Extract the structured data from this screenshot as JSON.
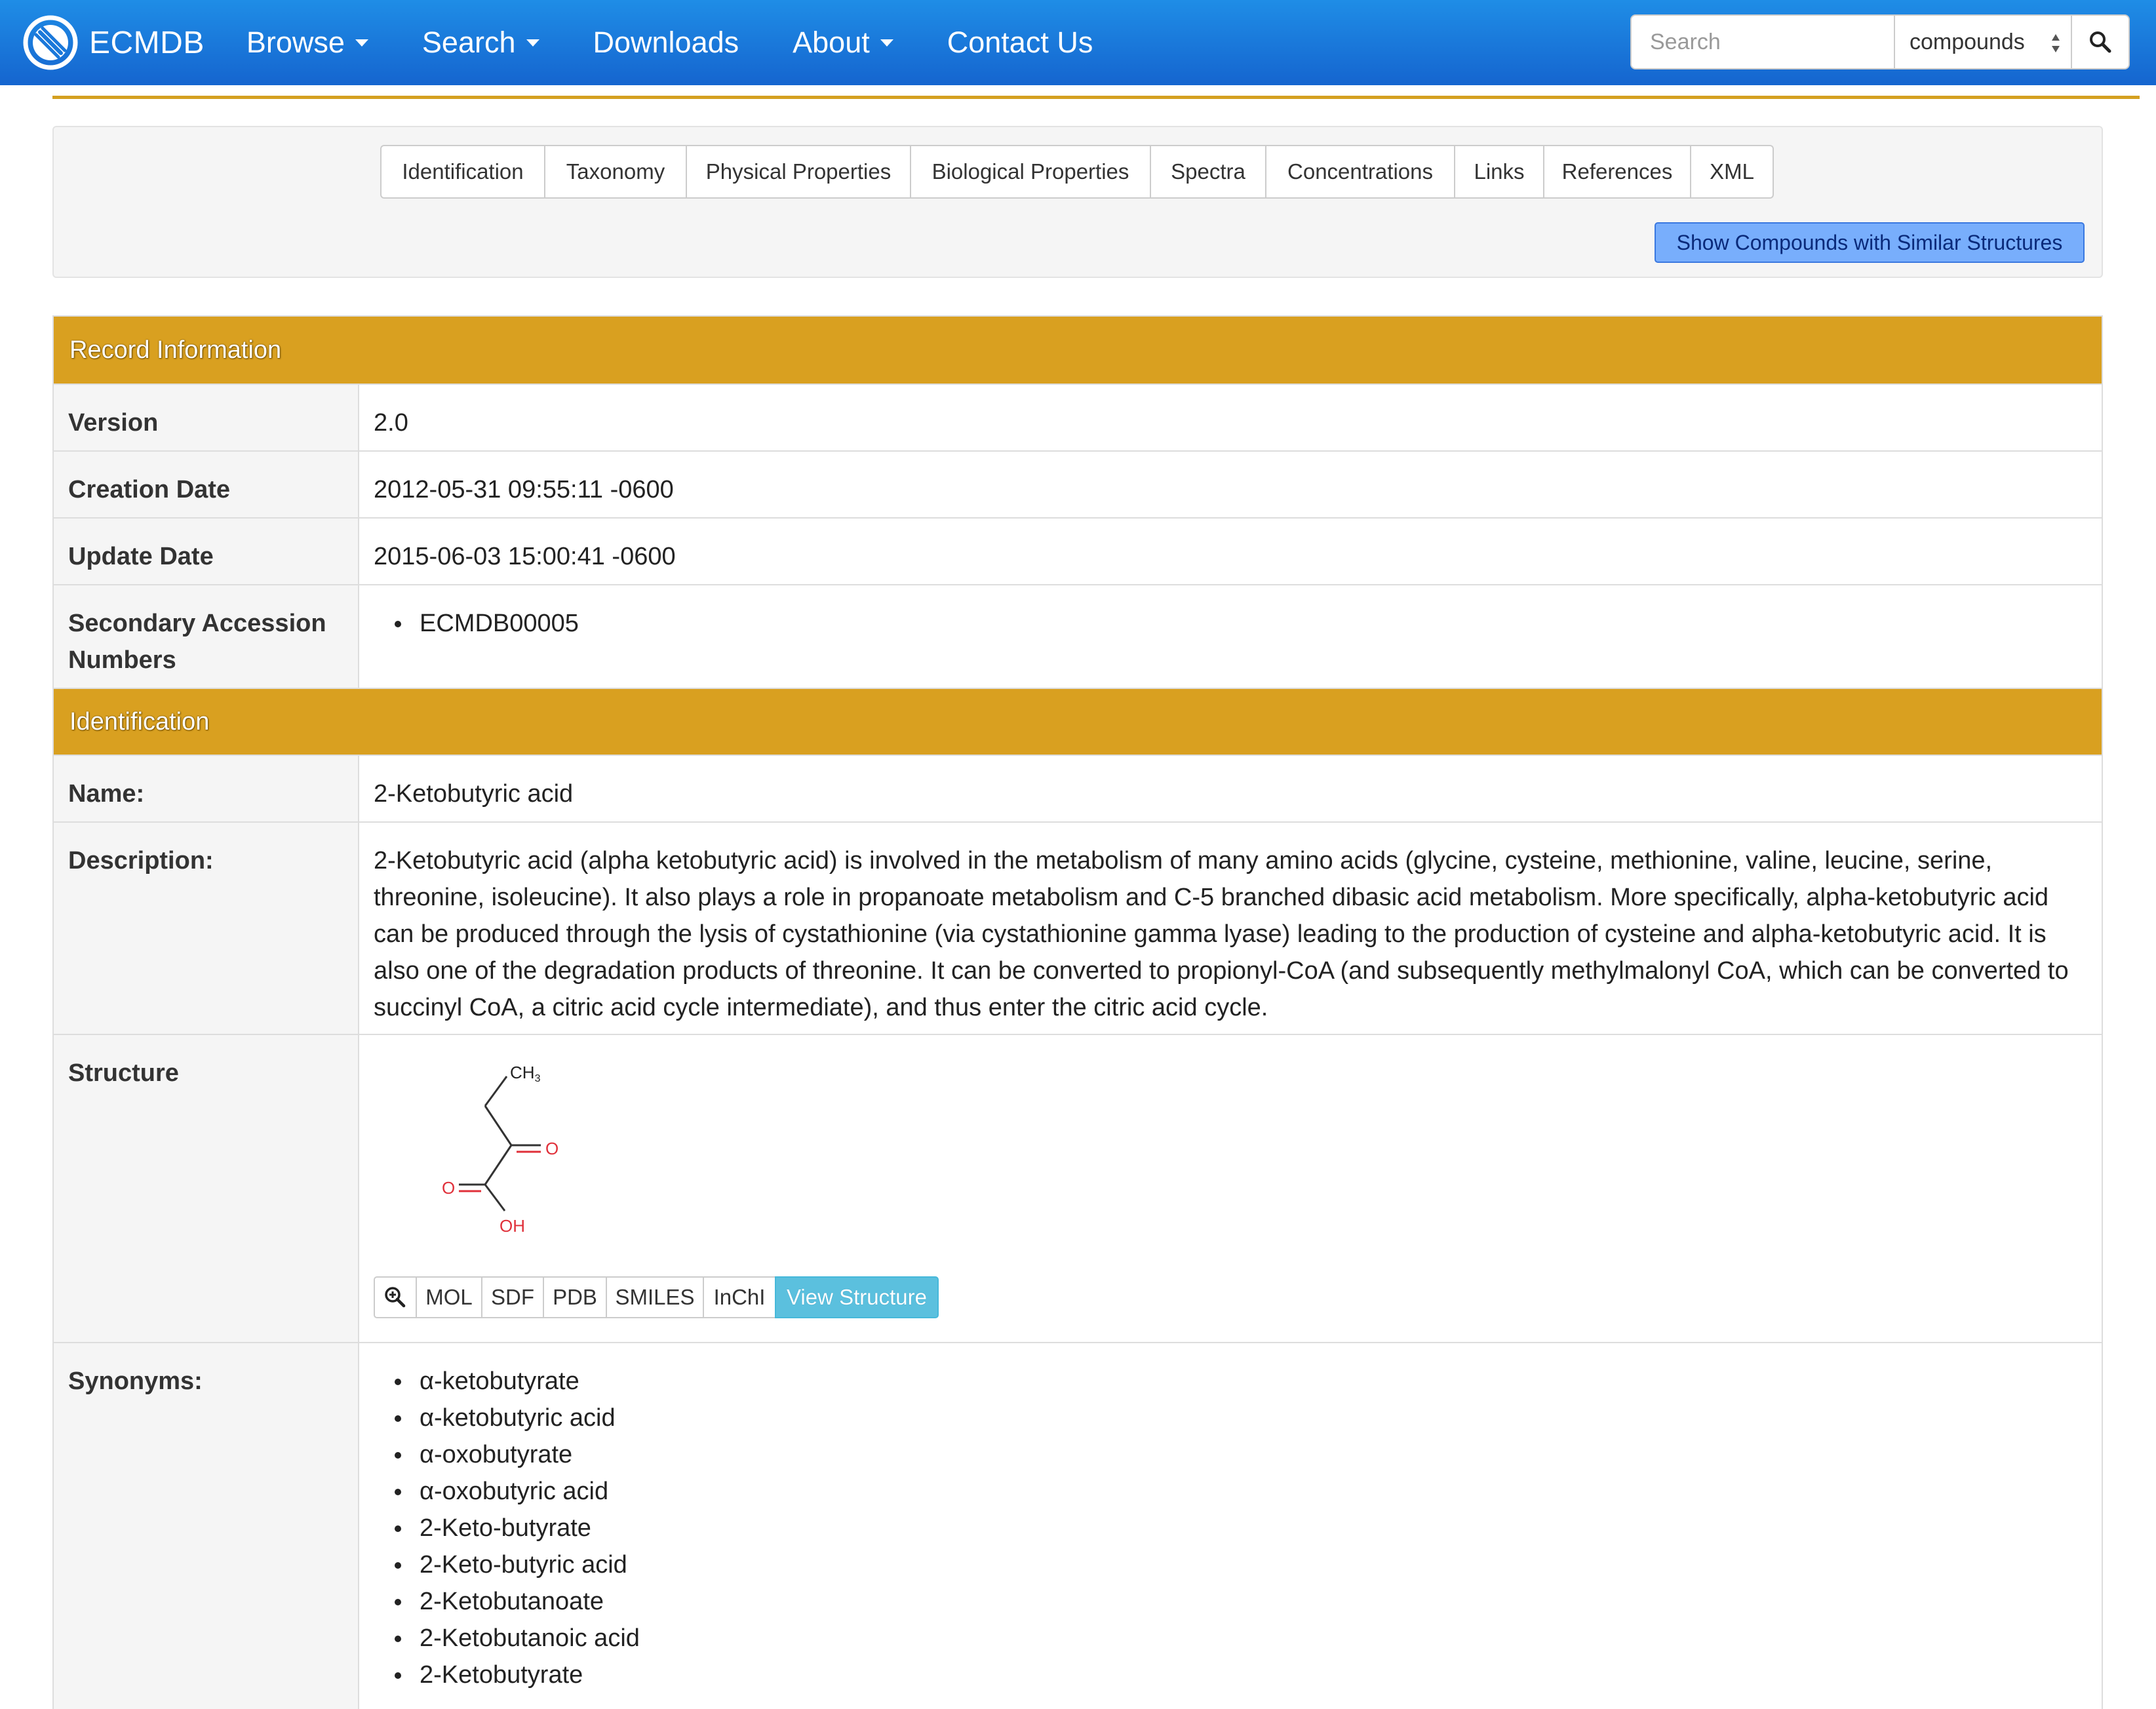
{
  "navbar": {
    "brand": "ECMDB",
    "items": [
      {
        "label": "Browse",
        "dropdown": true
      },
      {
        "label": "Search",
        "dropdown": true
      },
      {
        "label": "Downloads",
        "dropdown": false
      },
      {
        "label": "About",
        "dropdown": true
      },
      {
        "label": "Contact Us",
        "dropdown": false
      }
    ],
    "search": {
      "placeholder": "Search",
      "selected_scope": "compounds"
    }
  },
  "tabs": [
    "Identification",
    "Taxonomy",
    "Physical Properties",
    "Biological Properties",
    "Spectra",
    "Concentrations",
    "Links",
    "References",
    "XML"
  ],
  "similar_button": "Show Compounds with Similar Structures",
  "record_information": {
    "heading": "Record Information",
    "version": {
      "label": "Version",
      "value": "2.0"
    },
    "creation_date": {
      "label": "Creation Date",
      "value": "2012-05-31 09:55:11 -0600"
    },
    "update_date": {
      "label": "Update Date",
      "value": "2015-06-03 15:00:41 -0600"
    },
    "secondary_accession": {
      "label": "Secondary Accession Numbers",
      "values": [
        "ECMDB00005"
      ]
    }
  },
  "identification": {
    "heading": "Identification",
    "name": {
      "label": "Name:",
      "value": "2-Ketobutyric acid"
    },
    "description": {
      "label": "Description:",
      "value": "2-Ketobutyric acid (alpha ketobutyric acid) is involved in the metabolism of many amino acids (glycine, cysteine, methionine, valine, leucine, serine, threonine, isoleucine). It also plays a role in propanoate metabolism and C-5 branched dibasic acid metabolism. More specifically, alpha-ketobutyric acid can be produced through the lysis of cystathionine (via cystathionine gamma lyase) leading to the production of cysteine and alpha-ketobutyric acid. It is also one of the degradation products of threonine. It can be converted to propionyl-CoA (and subsequently methylmalonyl CoA, which can be converted to succinyl CoA, a citric acid cycle intermediate), and thus enter the citric acid cycle."
    },
    "structure": {
      "label": "Structure",
      "atom_labels": {
        "methyl": "CH",
        "methyl_sub": "3",
        "keto_o": "O",
        "acid_o": "O",
        "hydroxyl": "OH"
      },
      "buttons": [
        "MOL",
        "SDF",
        "PDB",
        "SMILES",
        "InChI"
      ],
      "view_button": "View Structure"
    },
    "synonyms": {
      "label": "Synonyms:",
      "values": [
        "α-ketobutyrate",
        "α-ketobutyric acid",
        "α-oxobutyrate",
        "α-oxobutyric acid",
        "2-Keto-butyrate",
        "2-Keto-butyric acid",
        "2-Ketobutanoate",
        "2-Ketobutanoic acid",
        "2-Ketobutyrate"
      ]
    }
  }
}
